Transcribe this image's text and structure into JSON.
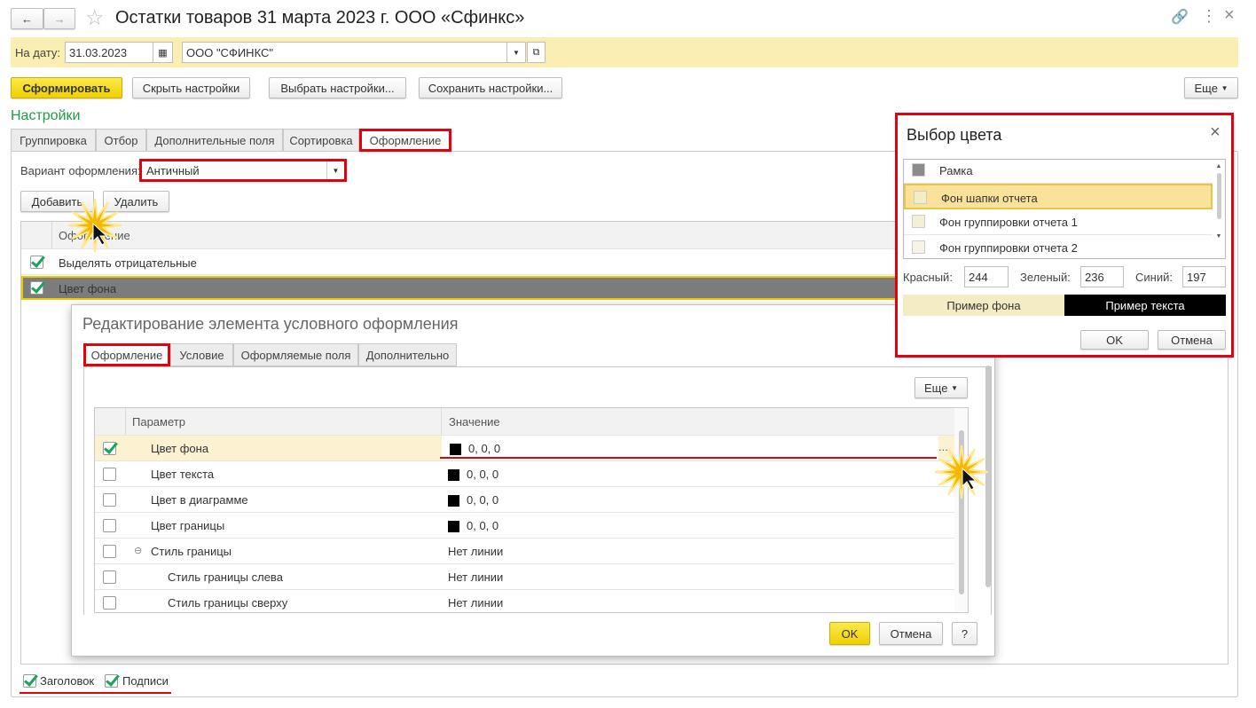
{
  "window": {
    "title": "Остатки товаров 31 марта 2023 г. ООО «Сфинкс»",
    "back": "←",
    "forward": "→"
  },
  "params": {
    "date_label": "На дату:",
    "date_value": "31.03.2023",
    "org_value": "ООО \"СФИНКС\""
  },
  "toolbar": {
    "generate": "Сформировать",
    "hide": "Скрыть настройки",
    "choose": "Выбрать настройки...",
    "save": "Сохранить настройки...",
    "more": "Еще"
  },
  "settings": {
    "heading": "Настройки",
    "tabs": [
      "Группировка",
      "Отбор",
      "Дополнительные поля",
      "Сортировка",
      "Оформление"
    ],
    "variant_label": "Вариант оформления:",
    "variant_value": "Античный",
    "add": "Добавить",
    "delete": "Удалить",
    "table_header": "Оформление",
    "rows": [
      {
        "label": "Выделять отрицательные",
        "checked": true
      },
      {
        "label": "Цвет фона",
        "checked": true
      }
    ],
    "bottom": [
      {
        "label": "Заголовок",
        "checked": true
      },
      {
        "label": "Подписи",
        "checked": true
      }
    ]
  },
  "edit_dialog": {
    "title": "Редактирование элемента условного оформления",
    "tabs": [
      "Оформление",
      "Условие",
      "Оформляемые поля",
      "Дополнительно"
    ],
    "more": "Еще",
    "col_param": "Параметр",
    "col_value": "Значение",
    "rows": [
      {
        "param": "Цвет фона",
        "value": "0, 0, 0",
        "checked": true,
        "swatch": true
      },
      {
        "param": "Цвет текста",
        "value": "0, 0, 0",
        "swatch": true
      },
      {
        "param": "Цвет в диаграмме",
        "value": "0, 0, 0",
        "swatch": true
      },
      {
        "param": "Цвет границы",
        "value": "0, 0, 0",
        "swatch": true
      },
      {
        "param": "Стиль границы",
        "value": "Нет линии",
        "collapse": "⊖"
      },
      {
        "param": "Стиль границы слева",
        "value": "Нет линии"
      },
      {
        "param": "Стиль границы сверху",
        "value": "Нет линии"
      }
    ],
    "ellipsis": "...",
    "ok": "OK",
    "cancel": "Отмена",
    "help": "?"
  },
  "color_dialog": {
    "title": "Выбор цвета",
    "close": "×",
    "items": [
      {
        "label": "Рамка",
        "color": "#8c8c8c"
      },
      {
        "label": "Фон шапки отчета",
        "color": "#f4ecc5"
      },
      {
        "label": "Фон группировки отчета 1",
        "color": "#f4f0d6"
      },
      {
        "label": "Фон группировки отчета 2",
        "color": "#f7f4e6"
      }
    ],
    "red_label": "Красный:",
    "red": "244",
    "green_label": "Зеленый:",
    "green": "236",
    "blue_label": "Синий:",
    "blue": "197",
    "bg_sample": "Пример фона",
    "text_sample": "Пример текста",
    "ok": "OK",
    "cancel": "Отмена"
  }
}
